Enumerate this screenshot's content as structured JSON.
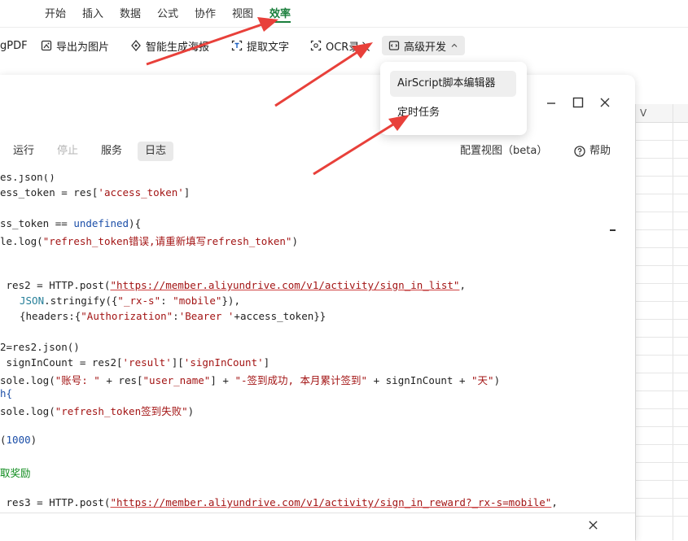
{
  "menu": {
    "items": [
      "开始",
      "插入",
      "数据",
      "公式",
      "协作",
      "视图",
      "效率"
    ],
    "active": "效率"
  },
  "toolbar": {
    "pdf_label": "gPDF",
    "export_image_label": "导出为图片",
    "poster_label": "智能生成海报",
    "extract_text_label": "提取文字",
    "ocr_label": "OCR录入",
    "advanced_label": "高级开发"
  },
  "dropdown": {
    "items": [
      "AirScript脚本编辑器",
      "定时任务"
    ]
  },
  "sheet": {
    "column_label": "V"
  },
  "editor": {
    "tabs": {
      "run": "运行",
      "stop": "停止",
      "service": "服务",
      "log": "日志"
    },
    "config_view": "配置视图（beta）",
    "help": "帮助"
  },
  "code": {
    "l1": "es.json()",
    "l2a": "ess_token = res[",
    "l2b": "'access_token'",
    "l2c": "]",
    "l3a": "ss_token == ",
    "l3b": "undefined",
    "l3c": "){",
    "l4a": "le.log(",
    "l4b": "\"refresh_token错误,请重新填写refresh_token\"",
    "l4c": ")",
    "l5a": " res2 = HTTP.post(",
    "l5b": "\"https://member.aliyundrive.com/v1/activity/sign_in_list\"",
    "l5c": ",",
    "l6a": "JSON",
    "l6b": ".stringify({",
    "l6c": "\"_rx-s\"",
    "l6d": ": ",
    "l6e": "\"mobile\"",
    "l6f": "}),",
    "l7a": "{headers:{",
    "l7b": "\"Authorization\"",
    "l7c": ":",
    "l7d": "'Bearer '",
    "l7e": "+access_token}}",
    "l8": "2=res2.json()",
    "l9a": " signInCount = res2[",
    "l9b": "'result'",
    "l9c": "][",
    "l9d": "'signInCount'",
    "l9e": "]",
    "l10a": "sole.log(",
    "l10b": "\"账号: \"",
    "l10c": " + res[",
    "l10d": "\"user_name\"",
    "l10e": "] + ",
    "l10f": "\"-签到成功, 本月累计签到\"",
    "l10g": " + signInCount + ",
    "l10h": "\"天\"",
    "l10i": ")",
    "l11": "h{",
    "l12a": "sole.log(",
    "l12b": "\"refresh_token签到失败\"",
    "l12c": ")",
    "l13a": "(",
    "l13b": "1000",
    "l13c": ")",
    "l14": "取奖励",
    "l15a": " res3 = HTTP.post(",
    "l15b": "\"https://member.aliyundrive.com/v1/activity/sign_in_reward?_rx-s=mobile\"",
    "l15c": ","
  },
  "colors": {
    "accent_green": "#1a7f3c",
    "arrow_red": "#e8403a"
  }
}
